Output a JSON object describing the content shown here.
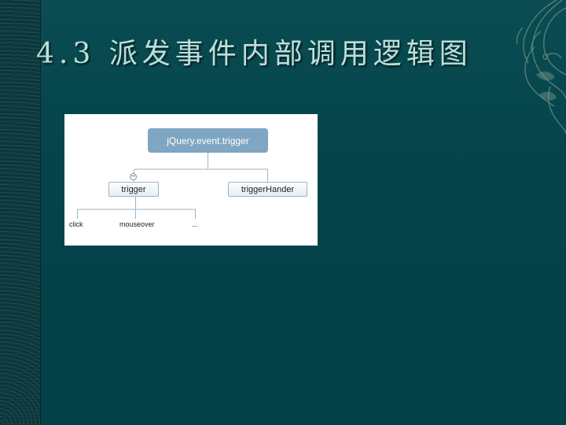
{
  "slide": {
    "title": "4.3 派发事件内部调用逻辑图"
  },
  "diagram": {
    "root": "jQuery.event.trigger",
    "children": [
      {
        "label": "trigger",
        "collapsed_toggle": "−",
        "children": [
          "click",
          "mouseover",
          "..."
        ]
      },
      {
        "label": "triggerHander",
        "children": []
      }
    ]
  },
  "colors": {
    "background": "#04424a",
    "title_text": "#b9e0dc",
    "root_node": "#7fa6c2",
    "connector": "#9db3c4"
  },
  "icons": {
    "corner": "phoenix-ornament-icon",
    "toggle": "collapse-minus-icon"
  }
}
